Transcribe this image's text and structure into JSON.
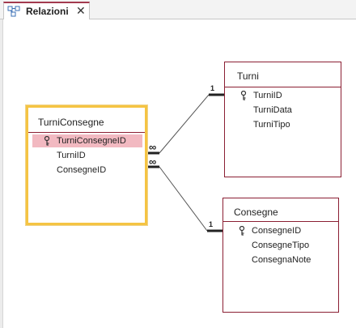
{
  "tab": {
    "label": "Relazioni",
    "close": "✕",
    "icon": "relationships-icon"
  },
  "tables": {
    "turniconsegne": {
      "title": "TurniConsegne",
      "fields": [
        {
          "name": "TurniConsegneID",
          "key": true
        },
        {
          "name": "TurniID",
          "key": false
        },
        {
          "name": "ConsegneID",
          "key": false
        }
      ]
    },
    "turni": {
      "title": "Turni",
      "fields": [
        {
          "name": "TurniID",
          "key": true
        },
        {
          "name": "TurniData",
          "key": false
        },
        {
          "name": "TurniTipo",
          "key": false
        }
      ]
    },
    "consegne": {
      "title": "Consegne",
      "fields": [
        {
          "name": "ConsegneID",
          "key": true
        },
        {
          "name": "ConsegneTipo",
          "key": false
        },
        {
          "name": "ConsegnaNote",
          "key": false
        }
      ]
    }
  },
  "relationships": {
    "turni_one": "1",
    "turni_many": "∞",
    "consegne_one": "1",
    "consegne_many": "∞"
  },
  "colors": {
    "table_border": "#8b1f33",
    "selected_border": "#f5c443",
    "highlight_row": "#f2b9c1",
    "tab_accent": "#a33a4f"
  }
}
